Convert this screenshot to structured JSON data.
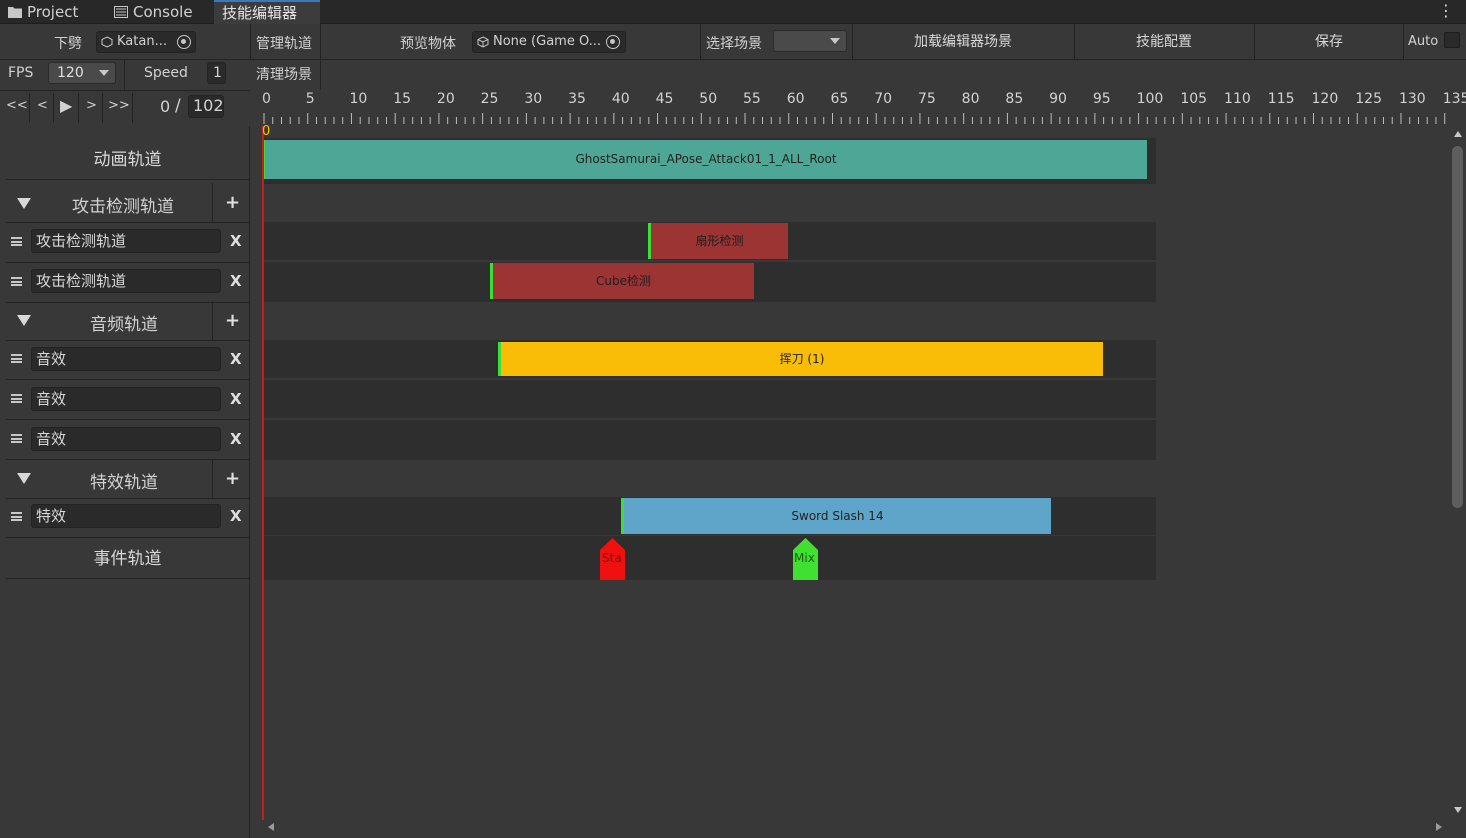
{
  "tabs": [
    {
      "label": "Project",
      "icon": "folder-icon"
    },
    {
      "label": "Console",
      "icon": "console-icon"
    },
    {
      "label": "技能编辑器",
      "icon": ""
    }
  ],
  "toolbar": {
    "character_label": "下劈",
    "character_value": "Katan...",
    "manage_tracks": "管理轨道",
    "clear_scene": "清理场景",
    "preview_label": "预览物体",
    "preview_value": "None (Game O...",
    "select_scene_label": "选择场景",
    "select_scene_value": "",
    "load_scene": "加载编辑器场景",
    "skill_config": "技能配置",
    "save": "保存",
    "auto_label": "Auto",
    "fps_label": "FPS",
    "fps_value": "120",
    "speed_label": "Speed",
    "speed_value": "1"
  },
  "playback": {
    "first": "<<",
    "prev": "<",
    "play": "▶",
    "next": ">",
    "last": ">>",
    "current": "0",
    "separator": "/",
    "total": "102"
  },
  "ruler": {
    "labels": [
      "0",
      "5",
      "10",
      "15",
      "20",
      "25",
      "30",
      "35",
      "40",
      "45",
      "50",
      "55",
      "60",
      "65",
      "70",
      "75",
      "80",
      "85",
      "90",
      "95",
      "100",
      "105",
      "110",
      "115",
      "120",
      "125",
      "130",
      "135"
    ],
    "marker": "0"
  },
  "left": {
    "animation": "动画轨道",
    "attack_group": "攻击检测轨道",
    "attack_tracks": [
      "攻击检测轨道",
      "攻击检测轨道"
    ],
    "audio_group": "音频轨道",
    "audio_tracks": [
      "音效",
      "音效",
      "音效"
    ],
    "effect_group": "特效轨道",
    "effect_tracks": [
      "特效"
    ],
    "event": "事件轨道",
    "plus": "+",
    "remove": "X"
  },
  "clips": {
    "animation": "GhostSamurai_APose_Attack01_1_ALL_Root",
    "sector": "扇形检测",
    "cube": "Cube检测",
    "audio": "挥刀 (1)",
    "effect": "Sword Slash 14"
  },
  "events": [
    "Sta",
    "Mix"
  ],
  "colors": {
    "animation": "#4ea696",
    "attack": "#9c3434",
    "audio": "#f9bd07",
    "effect": "#5ea5c9",
    "event_start": "#ef1010",
    "event_mix": "#3fe030",
    "clip_edge": "#38e038",
    "playhead": "#c41e1e",
    "tab_accent": "#3a79bb"
  }
}
